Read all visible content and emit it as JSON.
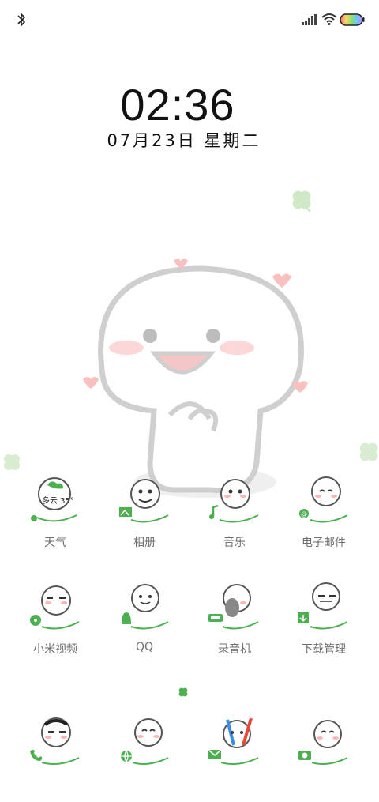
{
  "status": {
    "bluetooth": "bluetooth-icon",
    "signal": "signal-icon",
    "wifi": "wifi-icon",
    "battery": "battery-icon"
  },
  "lockscreen": {
    "time": "02:36",
    "date": "07月23日 星期二"
  },
  "apps": [
    {
      "label": "天气",
      "icon": "weather-icon",
      "badge": "多云 35°"
    },
    {
      "label": "相册",
      "icon": "gallery-icon"
    },
    {
      "label": "音乐",
      "icon": "music-icon"
    },
    {
      "label": "电子邮件",
      "icon": "email-icon"
    },
    {
      "label": "小米视频",
      "icon": "video-icon"
    },
    {
      "label": "QQ",
      "icon": "qq-icon"
    },
    {
      "label": "录音机",
      "icon": "recorder-icon"
    },
    {
      "label": "下载管理",
      "icon": "download-icon"
    },
    {
      "icon": "phone-icon"
    },
    {
      "icon": "browser-icon"
    },
    {
      "icon": "messages-icon"
    },
    {
      "icon": "camera-icon"
    }
  ],
  "colors": {
    "accent_green": "#4caf50",
    "cheek_pink": "#f7b7b7",
    "outline": "#555555"
  }
}
